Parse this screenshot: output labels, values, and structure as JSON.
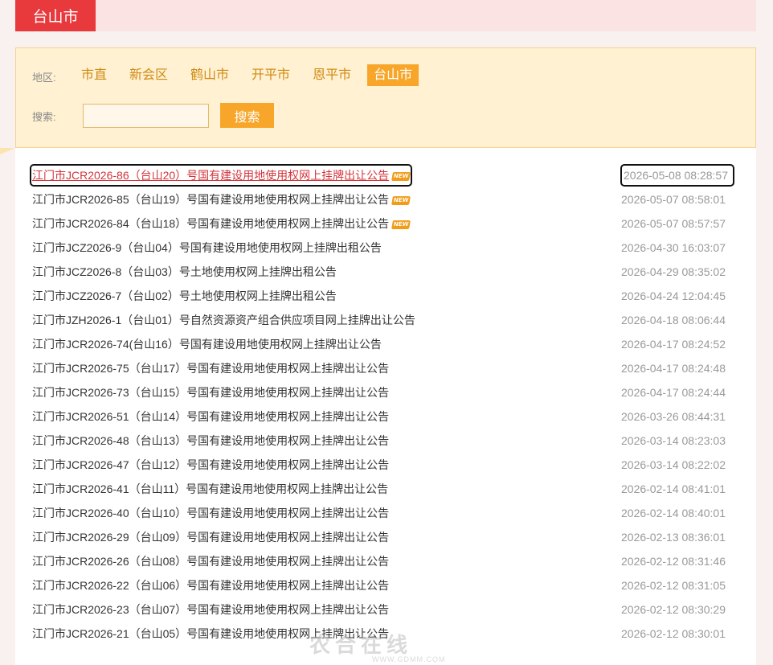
{
  "header": {
    "tab_label": "台山市"
  },
  "filters": {
    "region_label": "地区:",
    "regions": [
      {
        "label": "市直",
        "active": false
      },
      {
        "label": "新会区",
        "active": false
      },
      {
        "label": "鹤山市",
        "active": false
      },
      {
        "label": "开平市",
        "active": false
      },
      {
        "label": "恩平市",
        "active": false
      },
      {
        "label": "台山市",
        "active": true
      }
    ],
    "search_label": "搜索:",
    "search_value": "",
    "search_button": "搜索"
  },
  "notices": [
    {
      "title": "江门市JCR2026-86（台山20）号国有建设用地使用权网上挂牌出让公告",
      "date": "2026-05-08 08:28:57",
      "is_new": true,
      "highlighted": true
    },
    {
      "title": "江门市JCR2026-85（台山19）号国有建设用地使用权网上挂牌出让公告",
      "date": "2026-05-07 08:58:01",
      "is_new": true,
      "highlighted": false
    },
    {
      "title": "江门市JCR2026-84（台山18）号国有建设用地使用权网上挂牌出让公告",
      "date": "2026-05-07 08:57:57",
      "is_new": true,
      "highlighted": false
    },
    {
      "title": "江门市JCZ2026-9（台山04）号国有建设用地使用权网上挂牌出租公告",
      "date": "2026-04-30 16:03:07",
      "is_new": false,
      "highlighted": false
    },
    {
      "title": "江门市JCZ2026-8（台山03）号土地使用权网上挂牌出租公告",
      "date": "2026-04-29 08:35:02",
      "is_new": false,
      "highlighted": false
    },
    {
      "title": "江门市JCZ2026-7（台山02）号土地使用权网上挂牌出租公告",
      "date": "2026-04-24 12:04:45",
      "is_new": false,
      "highlighted": false
    },
    {
      "title": "江门市JZH2026-1（台山01）号自然资源资产组合供应项目网上挂牌出让公告",
      "date": "2026-04-18 08:06:44",
      "is_new": false,
      "highlighted": false
    },
    {
      "title": "江门市JCR2026-74(台山16）号国有建设用地使用权网上挂牌出让公告",
      "date": "2026-04-17 08:24:52",
      "is_new": false,
      "highlighted": false
    },
    {
      "title": "江门市JCR2026-75（台山17）号国有建设用地使用权网上挂牌出让公告",
      "date": "2026-04-17 08:24:48",
      "is_new": false,
      "highlighted": false
    },
    {
      "title": "江门市JCR2026-73（台山15）号国有建设用地使用权网上挂牌出让公告",
      "date": "2026-04-17 08:24:44",
      "is_new": false,
      "highlighted": false
    },
    {
      "title": "江门市JCR2026-51（台山14）号国有建设用地使用权网上挂牌出让公告",
      "date": "2026-03-26 08:44:31",
      "is_new": false,
      "highlighted": false
    },
    {
      "title": "江门市JCR2026-48（台山13）号国有建设用地使用权网上挂牌出让公告",
      "date": "2026-03-14 08:23:03",
      "is_new": false,
      "highlighted": false
    },
    {
      "title": "江门市JCR2026-47（台山12）号国有建设用地使用权网上挂牌出让公告",
      "date": "2026-03-14 08:22:02",
      "is_new": false,
      "highlighted": false
    },
    {
      "title": "江门市JCR2026-41（台山11）号国有建设用地使用权网上挂牌出让公告",
      "date": "2026-02-14 08:41:01",
      "is_new": false,
      "highlighted": false
    },
    {
      "title": "江门市JCR2026-40（台山10）号国有建设用地使用权网上挂牌出让公告",
      "date": "2026-02-14 08:40:01",
      "is_new": false,
      "highlighted": false
    },
    {
      "title": "江门市JCR2026-29（台山09）号国有建设用地使用权网上挂牌出让公告",
      "date": "2026-02-13 08:36:01",
      "is_new": false,
      "highlighted": false
    },
    {
      "title": "江门市JCR2026-26（台山08）号国有建设用地使用权网上挂牌出让公告",
      "date": "2026-02-12 08:31:46",
      "is_new": false,
      "highlighted": false
    },
    {
      "title": "江门市JCR2026-22（台山06）号国有建设用地使用权网上挂牌出让公告",
      "date": "2026-02-12 08:31:05",
      "is_new": false,
      "highlighted": false
    },
    {
      "title": "江门市JCR2026-23（台山07）号国有建设用地使用权网上挂牌出让公告",
      "date": "2026-02-12 08:30:29",
      "is_new": false,
      "highlighted": false
    },
    {
      "title": "江门市JCR2026-21（台山05）号国有建设用地使用权网上挂牌出让公告",
      "date": "2026-02-12 08:30:01",
      "is_new": false,
      "highlighted": false
    }
  ],
  "badge_text": "NEW",
  "watermark": {
    "main": "农合在线",
    "sub": "WWW.GDMM.COM"
  },
  "colors": {
    "accent_red": "#e8393d",
    "accent_orange": "#f7a62a",
    "link_active": "#d3333a"
  }
}
